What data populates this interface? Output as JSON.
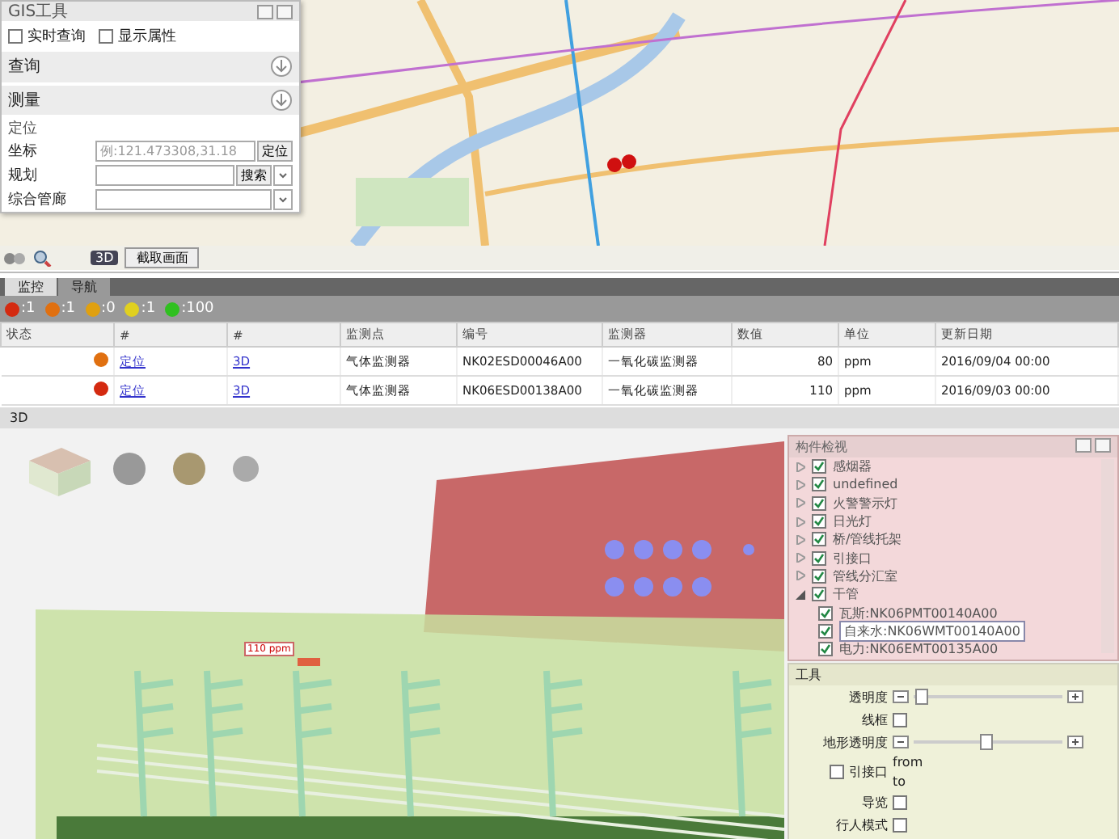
{
  "gis_panel": {
    "title": "GIS工具",
    "options": [
      {
        "label": "实时查询",
        "checked": false
      },
      {
        "label": "显示属性",
        "checked": false
      }
    ],
    "sections": [
      {
        "label": "查询"
      },
      {
        "label": "测量"
      }
    ],
    "locate": {
      "label": "定位",
      "fields": [
        {
          "kind": "button",
          "label": "坐标",
          "placeholder": "例:121.473308,31.18",
          "button": "定位"
        },
        {
          "kind": "combo",
          "label": "规划",
          "button": "搜索"
        },
        {
          "kind": "select",
          "label": "综合管廊"
        }
      ]
    },
    "capture_button": "截取画面",
    "view_3d": "3D"
  },
  "tabs": [
    {
      "label": "监控",
      "selected": true
    },
    {
      "label": "导航",
      "selected": false
    }
  ],
  "legend": [
    {
      "count": ":1",
      "color": "#d42a10"
    },
    {
      "count": ":1",
      "color": "#e07010"
    },
    {
      "count": ":0",
      "color": "#e0a010"
    },
    {
      "count": ":1",
      "color": "#e0d020"
    },
    {
      "count": ":100",
      "color": "#30c020"
    }
  ],
  "table": {
    "columns": [
      "状态",
      "#",
      "#",
      "监测点",
      "编号",
      "监测器",
      "数值",
      "单位",
      "更新日期"
    ],
    "rows": [
      {
        "color": "#e07010",
        "locate": "定位",
        "view": "3D",
        "point": "气体监测器",
        "code": "NK02ESD00046A00",
        "sensor": "一氧化碳监测器",
        "value": "80",
        "unit": "ppm",
        "date": "2016/09/04 00:00"
      },
      {
        "color": "#d42a10",
        "locate": "定位",
        "view": "3D",
        "point": "气体监测器",
        "code": "NK06ESD00138A00",
        "sensor": "一氧化碳监测器",
        "value": "110",
        "unit": "ppm",
        "date": "2016/09/03 00:00"
      }
    ]
  },
  "scene": {
    "title": "3D",
    "label": "110 ppm"
  },
  "tree_panel": {
    "title": "构件检视",
    "items": [
      {
        "label": "感烟器",
        "checked": true,
        "expanded": false,
        "selected": false
      },
      {
        "label": "undefined",
        "checked": true,
        "expanded": false,
        "selected": false
      },
      {
        "label": "火警警示灯",
        "checked": true,
        "expanded": false,
        "selected": false
      },
      {
        "label": "日光灯",
        "checked": true,
        "expanded": false,
        "selected": false
      },
      {
        "label": "桥/管线托架",
        "checked": true,
        "expanded": false,
        "selected": false
      },
      {
        "label": "引接口",
        "checked": true,
        "expanded": false,
        "selected": false
      },
      {
        "label": "管线分汇室",
        "checked": true,
        "expanded": false,
        "selected": false
      },
      {
        "label": "干管",
        "checked": true,
        "expanded": true,
        "selected": false,
        "children": [
          {
            "label": "瓦斯:NK06PMT00140A00",
            "checked": true,
            "selected": false
          },
          {
            "label": "自来水:NK06WMT00140A00",
            "checked": true,
            "selected": true
          },
          {
            "label": "电力:NK06EMT00135A00",
            "checked": true,
            "selected": false
          }
        ]
      }
    ]
  },
  "tools_panel": {
    "title": "工具",
    "rows": [
      {
        "kind": "slider",
        "label": "透明度",
        "level": 0.02
      },
      {
        "kind": "check",
        "label": "线框",
        "checked": false
      },
      {
        "kind": "slider",
        "label": "地形透明度",
        "level": 0.5
      },
      {
        "kind": "range",
        "label": "引接口",
        "checked": false,
        "from": "from",
        "to": "to"
      },
      {
        "kind": "check",
        "label": "导览",
        "checked": false
      },
      {
        "kind": "check",
        "label": "行人模式",
        "checked": false
      }
    ]
  }
}
